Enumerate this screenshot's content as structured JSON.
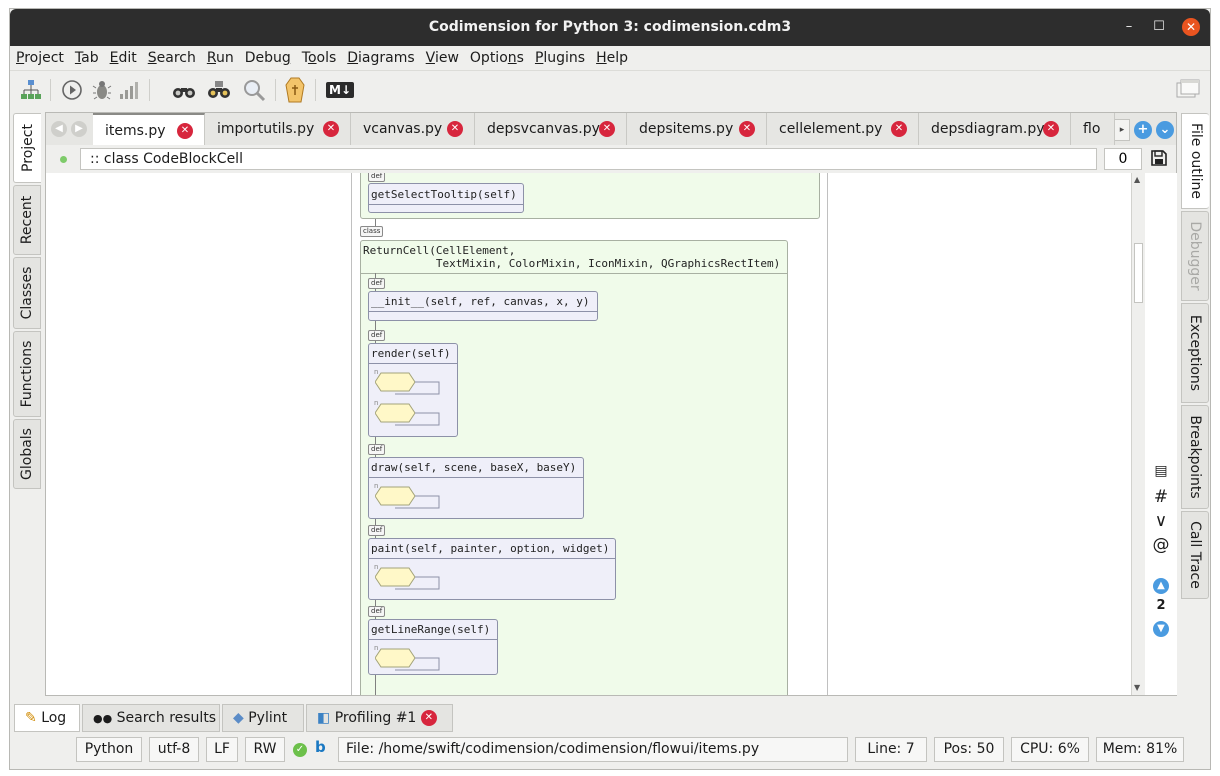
{
  "window": {
    "title": "Codimension for Python 3: codimension.cdm3"
  },
  "menu": [
    "Project",
    "Tab",
    "Edit",
    "Search",
    "Run",
    "Debug",
    "Tools",
    "Diagrams",
    "View",
    "Options",
    "Plugins",
    "Help"
  ],
  "menu_underline": [
    0,
    0,
    0,
    0,
    0,
    4,
    1,
    0,
    0,
    5,
    0,
    0
  ],
  "toolbar": {
    "markdown_label": "M↓"
  },
  "left_tabs": [
    "Project",
    "Recent",
    "Classes",
    "Functions",
    "Globals"
  ],
  "right_tabs": [
    "File outline",
    "Debugger",
    "Exceptions",
    "Breakpoints",
    "Call Trace"
  ],
  "tabs": [
    "items.py",
    "importutils.py",
    "vcanvas.py",
    "depsvcanvas.py",
    "depsitems.py",
    "cellelement.py",
    "depsdiagram.py",
    "flo"
  ],
  "breadcrumb": {
    "path": ":: class CodeBlockCell",
    "number": "0"
  },
  "side": {
    "count": "2"
  },
  "diagram": {
    "def_badge": "def",
    "class_badge": "class",
    "branch_mark": "n",
    "top_def": "getSelectTooltip(self)",
    "class_sig": "ReturnCell(CellElement,\n           TextMixin, ColorMixin, IconMixin, QGraphicsRectItem)",
    "defs": [
      "__init__(self, ref, canvas, x, y)",
      "render(self)",
      "draw(self, scene, baseX, baseY)",
      "paint(self, painter, option, widget)",
      "getLineRange(self)"
    ]
  },
  "bottom_tabs": [
    "Log",
    "Search results",
    "Pylint",
    "Profiling #1"
  ],
  "status": {
    "language": "Python",
    "encoding": "utf-8",
    "eol": "LF",
    "mode": "RW",
    "vcs_mark": "b",
    "file": "File: /home/swift/codimension/codimension/flowui/items.py",
    "line": "Line: 7",
    "pos": "Pos: 50",
    "cpu": "CPU:  6%",
    "mem": "Mem: 81%"
  },
  "colors": {
    "accent": "#4a9be0",
    "close": "#d7263d",
    "class_fill": "#f0fbea",
    "def_fill": "#efeff9",
    "block_fill": "#fff8c8"
  }
}
